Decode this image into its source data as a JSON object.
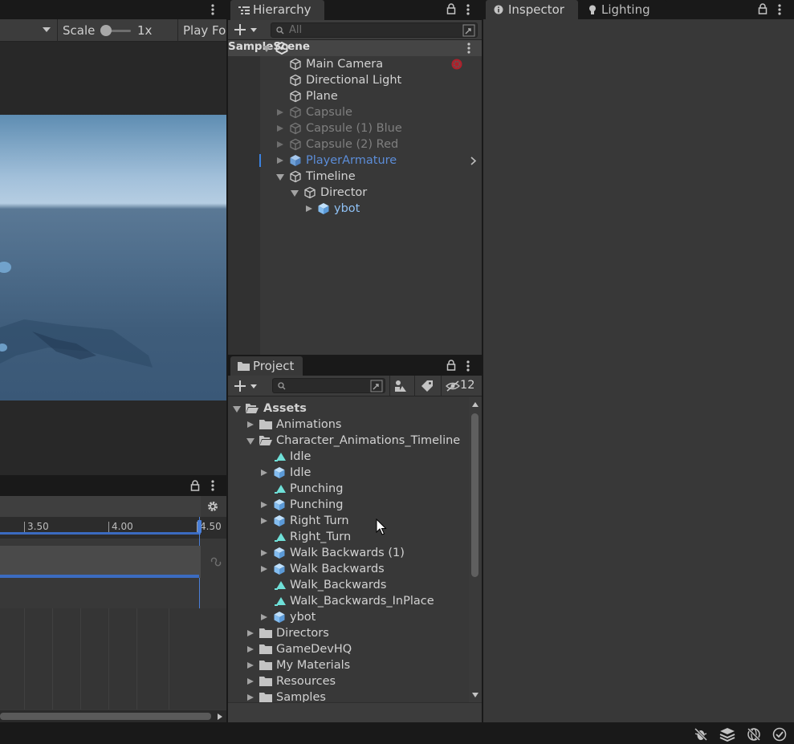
{
  "game": {
    "scale_label": "Scale",
    "scale_value": "1x",
    "play_label": "Play Fo"
  },
  "timeline": {
    "ticks": [
      "3.50",
      "4.00",
      "4.50"
    ]
  },
  "hierarchy": {
    "tab": "Hierarchy",
    "search_placeholder": "All",
    "scene": "SampleScene",
    "items": [
      {
        "label": "Main Camera",
        "state": "normal"
      },
      {
        "label": "Directional Light",
        "state": "normal"
      },
      {
        "label": "Plane",
        "state": "normal"
      },
      {
        "label": "Capsule",
        "state": "disabled"
      },
      {
        "label": "Capsule (1) Blue",
        "state": "disabled"
      },
      {
        "label": "Capsule (2) Red",
        "state": "disabled"
      },
      {
        "label": "PlayerArmature",
        "state": "prefab"
      },
      {
        "label": "Timeline",
        "state": "normal"
      },
      {
        "label": "Director",
        "state": "normal"
      },
      {
        "label": "ybot",
        "state": "prefab-light"
      }
    ]
  },
  "project": {
    "tab": "Project",
    "hidden_count": "12",
    "items": [
      {
        "label": "Assets",
        "type": "folder-open"
      },
      {
        "label": "Animations",
        "type": "folder"
      },
      {
        "label": "Character_Animations_Timeline",
        "type": "folder-open"
      },
      {
        "label": "Idle",
        "type": "anim"
      },
      {
        "label": "Idle",
        "type": "model"
      },
      {
        "label": "Punching",
        "type": "anim"
      },
      {
        "label": "Punching",
        "type": "model"
      },
      {
        "label": "Right Turn",
        "type": "model"
      },
      {
        "label": "Right_Turn",
        "type": "anim"
      },
      {
        "label": "Walk Backwards (1)",
        "type": "model"
      },
      {
        "label": "Walk Backwards",
        "type": "model"
      },
      {
        "label": "Walk_Backwards",
        "type": "anim"
      },
      {
        "label": "Walk_Backwards_InPlace",
        "type": "anim"
      },
      {
        "label": "ybot",
        "type": "model"
      },
      {
        "label": "Directors",
        "type": "folder"
      },
      {
        "label": "GameDevHQ",
        "type": "folder"
      },
      {
        "label": "My Materials",
        "type": "folder"
      },
      {
        "label": "Resources",
        "type": "folder"
      },
      {
        "label": "Samples",
        "type": "folder"
      }
    ]
  },
  "inspector": {
    "tabs": [
      "Inspector",
      "Lighting"
    ]
  },
  "colors": {
    "accent_blue": "#5c8dd8",
    "prefab_light_blue": "#8fc1f5",
    "anim_teal": "#6fe0d8",
    "panel_bg": "#383838"
  }
}
